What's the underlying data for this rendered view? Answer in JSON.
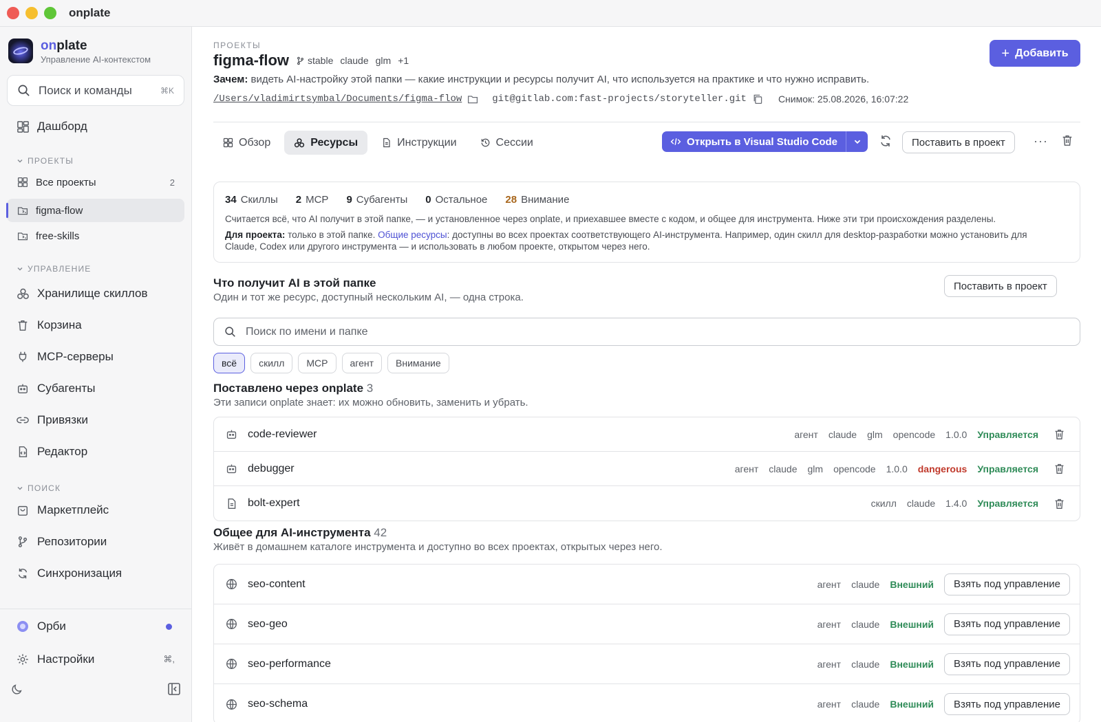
{
  "window": {
    "title": "onplate"
  },
  "brand": {
    "name_prefix": "on",
    "name_suffix": "plate",
    "subtitle": "Управление AI-контекстом"
  },
  "sidebar": {
    "search_placeholder": "Поиск и команды",
    "search_shortcut": "⌘K",
    "dashboard": "Дашборд",
    "projects_section": "ПРОЕКТЫ",
    "all_projects": "Все проекты",
    "all_projects_count": "2",
    "project_items": [
      "figma-flow",
      "free-skills"
    ],
    "manage_section": "УПРАВЛЕНИЕ",
    "manage_items": [
      "Хранилище скиллов",
      "Корзина",
      "MCP-серверы",
      "Субагенты",
      "Привязки",
      "Редактор"
    ],
    "search_section": "ПОИСК",
    "search_items": [
      "Маркетплейс",
      "Репозитории",
      "Синхронизация"
    ],
    "orbi": "Орби",
    "settings": "Настройки",
    "settings_shortcut": "⌘,"
  },
  "header": {
    "breadcrumb": "ПРОЕКТЫ",
    "title": "figma-flow",
    "tags": [
      "stable",
      "claude",
      "glm",
      "+1"
    ],
    "add_button": "Добавить",
    "why_label": "Зачем:",
    "why_text": " видеть AI-настройку этой папки — какие инструкции и ресурсы получит AI, что используется на практике и что нужно исправить.",
    "path": "/Users/vladimirtsymbal/Documents/figma-flow",
    "git": "git@gitlab.com:fast-projects/storyteller.git",
    "snapshot": "Снимок: 25.08.2026, 16:07:22"
  },
  "tabs": [
    "Обзор",
    "Ресурсы",
    "Инструкции",
    "Сессии"
  ],
  "toolbar": {
    "open_vscode": "Открыть в Visual Studio Code",
    "install": "Поставить в проект"
  },
  "summary": {
    "stats": [
      {
        "num": "34",
        "label": "Скиллы"
      },
      {
        "num": "2",
        "label": "MCP"
      },
      {
        "num": "9",
        "label": "Субагенты"
      },
      {
        "num": "0",
        "label": "Остальное"
      },
      {
        "num": "28",
        "label": "Внимание"
      }
    ],
    "line1": "Считается всё, что AI получит в этой папке, — и установленное через onplate, и приехавшее вместе с кодом, и общее для инструмента. Ниже эти три происхождения разделены.",
    "line2_label": "Для проекта:",
    "line2_a": " только в этой папке. ",
    "line2_link": "Общие ресурсы",
    "line2_b": ": доступны во всех проектах соответствующего AI-инструмента. Например, один скилл для desktop-разработки можно установить для Claude, Codex или другого инструмента — и использовать в любом проекте, открытом через него."
  },
  "ai_section": {
    "title": "Что получит AI в этой папке",
    "subtitle": "Один и тот же ресурс, доступный нескольким AI, — одна строка.",
    "install_button": "Поставить в проект",
    "search_placeholder": "Поиск по имени и папке",
    "chips": [
      "всё",
      "скилл",
      "MCP",
      "агент",
      "Внимание"
    ]
  },
  "installed": {
    "title": "Поставлено через onplate",
    "count": "3",
    "subtitle": "Эти записи onplate знает: их можно обновить, заменить и убрать.",
    "rows": [
      {
        "name": "code-reviewer",
        "meta": [
          "агент",
          "claude",
          "glm",
          "opencode",
          "1.0.0"
        ],
        "flag": "",
        "status": "Управляется"
      },
      {
        "name": "debugger",
        "meta": [
          "агент",
          "claude",
          "glm",
          "opencode",
          "1.0.0"
        ],
        "flag": "dangerous",
        "status": "Управляется"
      },
      {
        "name": "bolt-expert",
        "meta": [
          "скилл",
          "claude",
          "1.4.0"
        ],
        "flag": "",
        "status": "Управляется"
      }
    ]
  },
  "shared": {
    "title": "Общее для AI-инструмента",
    "count": "42",
    "subtitle": "Живёт в домашнем каталоге инструмента и доступно во всех проектах, открытых через него.",
    "take_button": "Взять под управление",
    "rows": [
      {
        "name": "seo-content",
        "meta": [
          "агент",
          "claude"
        ],
        "status": "Внешний"
      },
      {
        "name": "seo-geo",
        "meta": [
          "агент",
          "claude"
        ],
        "status": "Внешний"
      },
      {
        "name": "seo-performance",
        "meta": [
          "агент",
          "claude"
        ],
        "status": "Внешний"
      },
      {
        "name": "seo-schema",
        "meta": [
          "агент",
          "claude"
        ],
        "status": "Внешний"
      }
    ]
  },
  "colors": {
    "accent": "#5b5fe0",
    "managed": "#2e8b57",
    "danger": "#c0392b",
    "warn": "#a8661c"
  }
}
